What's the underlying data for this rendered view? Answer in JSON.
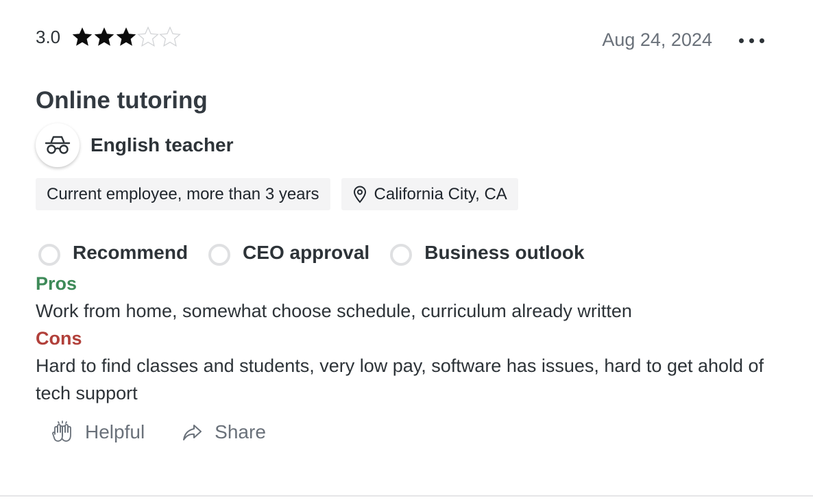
{
  "review": {
    "rating_value": "3.0",
    "rating": 3,
    "max_rating": 5,
    "date": "Aug 24, 2024",
    "title": "Online tutoring",
    "job_title": "English teacher",
    "employment": "Current employee, more than 3 years",
    "location": "California City, CA",
    "approvals": [
      {
        "label": "Recommend"
      },
      {
        "label": "CEO approval"
      },
      {
        "label": "Business outlook"
      }
    ],
    "pros_label": "Pros",
    "pros": "Work from home, somewhat choose schedule, curriculum already written",
    "cons_label": "Cons",
    "cons": "Hard to find classes and students, very low pay, software has issues, hard to get ahold of tech support"
  },
  "actions": {
    "helpful_label": "Helpful",
    "share_label": "Share"
  },
  "colors": {
    "pros": "#3d8a58",
    "cons": "#b1403a",
    "star_filled": "#0c0c0c",
    "star_empty": "#cfd1d4"
  },
  "icons": {
    "avatar": "anonymous-incognito-icon",
    "location": "map-pin-icon",
    "helpful": "high-five-hands-icon",
    "share": "share-arrow-icon",
    "more": "more-dots-icon"
  }
}
